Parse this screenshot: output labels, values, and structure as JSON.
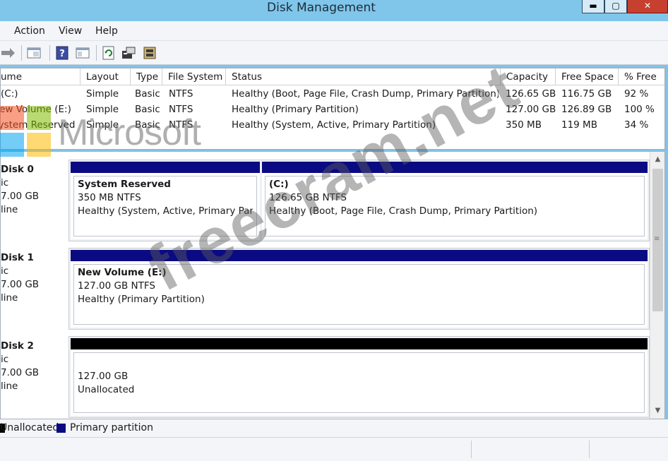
{
  "window": {
    "title": "Disk Management",
    "min_label": "▬",
    "max_label": "▢",
    "close_label": "✕"
  },
  "menu": {
    "action": "Action",
    "view": "View",
    "help": "Help"
  },
  "toolbar": {
    "icons": [
      "back-arrow-icon",
      "properties-pane-icon",
      "help-icon",
      "console-tree-icon",
      "refresh-icon",
      "properties-icon",
      "rescan-disks-icon"
    ]
  },
  "volume_table": {
    "columns": [
      "ume",
      "Layout",
      "Type",
      "File System",
      "Status",
      "Capacity",
      "Free Space",
      "% Free"
    ],
    "rows": [
      [
        "(C:)",
        "Simple",
        "Basic",
        "NTFS",
        "Healthy (Boot, Page File, Crash Dump, Primary Partition)",
        "126.65 GB",
        "116.75 GB",
        "92 %"
      ],
      [
        "New Volume (E:)",
        "Simple",
        "Basic",
        "NTFS",
        "Healthy (Primary Partition)",
        "127.00 GB",
        "126.89 GB",
        "100 %"
      ],
      [
        "System Reserved",
        "Simple",
        "Basic",
        "NTFS",
        "Healthy (System, Active, Primary Partition)",
        "350 MB",
        "119 MB",
        "34 %"
      ]
    ]
  },
  "disks": [
    {
      "name": "Disk 0",
      "type": "ic",
      "size": "7.00 GB",
      "status": "line",
      "partitions": [
        {
          "name": "System Reserved",
          "size": "350 MB NTFS",
          "status": "Healthy (System, Active, Primary Partit",
          "kind": "primary"
        },
        {
          "name": "(C:)",
          "size": "126.65 GB NTFS",
          "status": "Healthy (Boot, Page File, Crash Dump, Primary Partition)",
          "kind": "primary"
        }
      ]
    },
    {
      "name": "Disk 1",
      "type": "ic",
      "size": "7.00 GB",
      "status": "line",
      "partitions": [
        {
          "name": "New Volume  (E:)",
          "size": "127.00 GB NTFS",
          "status": "Healthy (Primary Partition)",
          "kind": "primary"
        }
      ]
    },
    {
      "name": "Disk 2",
      "type": "ic",
      "size": "7.00 GB",
      "status": "line",
      "partitions": [
        {
          "name": "",
          "size": "127.00 GB",
          "status": "Unallocated",
          "kind": "unallocated"
        }
      ]
    }
  ],
  "legend": {
    "unallocated": "Unallocated",
    "primary": "Primary partition"
  },
  "watermark": {
    "microsoft": "Microsoft",
    "site": "freecram.net"
  },
  "colors": {
    "primary_bar": "#0a0a82",
    "unallocated_bar": "#000000",
    "titlebar": "#7fc6ea",
    "close_button": "#c7402f"
  }
}
